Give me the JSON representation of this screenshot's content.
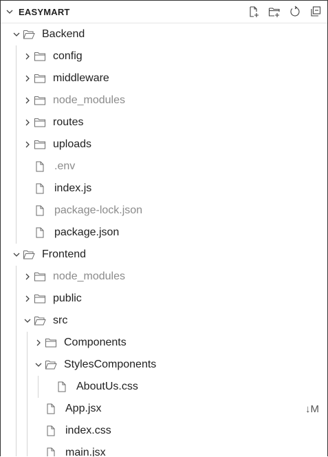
{
  "explorer": {
    "title": "EASYMART",
    "actions": [
      {
        "name": "new-file-icon"
      },
      {
        "name": "new-folder-icon"
      },
      {
        "name": "refresh-icon"
      },
      {
        "name": "collapse-all-icon"
      }
    ]
  },
  "tree": [
    {
      "label": "Backend",
      "type": "folder",
      "state": "expanded",
      "depth": 1,
      "dim": false,
      "badge": ""
    },
    {
      "label": "config",
      "type": "folder",
      "state": "collapsed",
      "depth": 2,
      "dim": false,
      "badge": ""
    },
    {
      "label": "middleware",
      "type": "folder",
      "state": "collapsed",
      "depth": 2,
      "dim": false,
      "badge": ""
    },
    {
      "label": "node_modules",
      "type": "folder",
      "state": "collapsed",
      "depth": 2,
      "dim": true,
      "badge": ""
    },
    {
      "label": "routes",
      "type": "folder",
      "state": "collapsed",
      "depth": 2,
      "dim": false,
      "badge": ""
    },
    {
      "label": "uploads",
      "type": "folder",
      "state": "collapsed",
      "depth": 2,
      "dim": false,
      "badge": ""
    },
    {
      "label": ".env",
      "type": "file",
      "depth": 2,
      "dim": true,
      "badge": ""
    },
    {
      "label": "index.js",
      "type": "file",
      "depth": 2,
      "dim": false,
      "badge": ""
    },
    {
      "label": "package-lock.json",
      "type": "file",
      "depth": 2,
      "dim": true,
      "badge": ""
    },
    {
      "label": "package.json",
      "type": "file",
      "depth": 2,
      "dim": false,
      "badge": ""
    },
    {
      "label": "Frontend",
      "type": "folder",
      "state": "expanded",
      "depth": 1,
      "dim": false,
      "badge": ""
    },
    {
      "label": "node_modules",
      "type": "folder",
      "state": "collapsed",
      "depth": 2,
      "dim": true,
      "badge": ""
    },
    {
      "label": "public",
      "type": "folder",
      "state": "collapsed",
      "depth": 2,
      "dim": false,
      "badge": ""
    },
    {
      "label": "src",
      "type": "folder",
      "state": "expanded",
      "depth": 2,
      "dim": false,
      "badge": ""
    },
    {
      "label": "Components",
      "type": "folder",
      "state": "collapsed",
      "depth": 3,
      "dim": false,
      "badge": ""
    },
    {
      "label": "StylesComponents",
      "type": "folder",
      "state": "expanded",
      "depth": 3,
      "dim": false,
      "badge": ""
    },
    {
      "label": "AboutUs.css",
      "type": "file",
      "depth": 4,
      "dim": false,
      "badge": ""
    },
    {
      "label": "App.jsx",
      "type": "file",
      "depth": 3,
      "dim": false,
      "badge": "↓M"
    },
    {
      "label": "index.css",
      "type": "file",
      "depth": 3,
      "dim": false,
      "badge": ""
    },
    {
      "label": "main.jsx",
      "type": "file",
      "depth": 3,
      "dim": false,
      "badge": ""
    }
  ],
  "colors": {
    "text": "#1f1f1f",
    "dim": "#8b8b8b",
    "icon": "#424242",
    "guide": "#d4d4d4"
  }
}
